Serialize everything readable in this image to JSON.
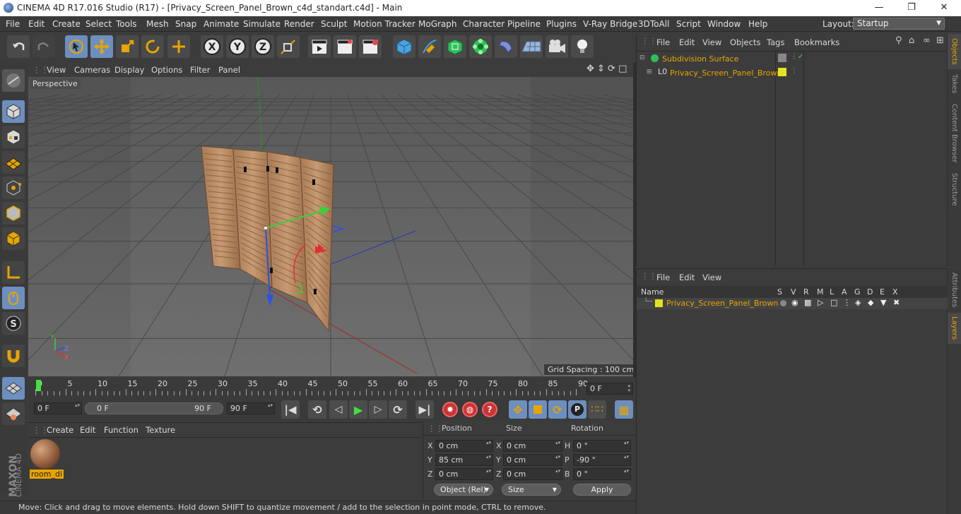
{
  "window": {
    "title": "CINEMA 4D R17.016 Studio (R17) - [Privacy_Screen_Panel_Brown_c4d_standart.c4d] - Main",
    "minimize": "—",
    "maximize": "❐",
    "close": "✕"
  },
  "menu": [
    "File",
    "Edit",
    "Create",
    "Select",
    "Tools",
    "Mesh",
    "Snap",
    "Animate",
    "Simulate",
    "Render",
    "Sculpt",
    "Motion Tracker",
    "MoGraph",
    "Character",
    "Pipeline",
    "Plugins",
    "V-Ray Bridge",
    "3DToAll",
    "Script",
    "Window",
    "Help"
  ],
  "layout": {
    "label": "Layout:",
    "value": "Startup"
  },
  "viewport": {
    "menu": [
      "View",
      "Cameras",
      "Display",
      "Options",
      "Filter",
      "Panel"
    ],
    "camera_label": "Perspective",
    "grid_spacing": "Grid Spacing : 100 cm",
    "axis_labels": {
      "y": "Y",
      "z": "Z",
      "x": "X"
    }
  },
  "timeline": {
    "ticks": [
      "0",
      "5",
      "10",
      "15",
      "20",
      "25",
      "30",
      "35",
      "40",
      "45",
      "50",
      "55",
      "60",
      "65",
      "70",
      "75",
      "80",
      "85",
      "90"
    ],
    "end_frame": "0 F"
  },
  "transport": {
    "current": "0 F",
    "range_start": "0 F",
    "range_end": "90 F",
    "max": "90 F"
  },
  "material_panel": {
    "menu": [
      "Create",
      "Edit",
      "Function",
      "Texture"
    ],
    "material_name": "room_di"
  },
  "coords": {
    "headers": [
      "Position",
      "Size",
      "Rotation"
    ],
    "rows": [
      {
        "axis": "X",
        "pos": "0 cm",
        "saxis": "X",
        "size": "0 cm",
        "raxis": "H",
        "rot": "0 °"
      },
      {
        "axis": "Y",
        "pos": "85 cm",
        "saxis": "Y",
        "size": "0 cm",
        "raxis": "P",
        "rot": "-90 °"
      },
      {
        "axis": "Z",
        "pos": "0 cm",
        "saxis": "Z",
        "size": "0 cm",
        "raxis": "B",
        "rot": "0 °"
      }
    ],
    "mode": "Object (Rel)",
    "size_mode": "Size",
    "apply": "Apply"
  },
  "objects_panel": {
    "menu": [
      "File",
      "Edit",
      "View",
      "Objects",
      "Tags",
      "Bookmarks"
    ],
    "items": [
      {
        "name": "Subdivision Surface"
      },
      {
        "name": "Privacy_Screen_Panel_Brown"
      }
    ]
  },
  "layers_panel": {
    "menu": [
      "File",
      "Edit",
      "View"
    ],
    "columns": [
      "Name",
      "S",
      "V",
      "R",
      "M",
      "L",
      "A",
      "G",
      "D",
      "E",
      "X"
    ],
    "items": [
      {
        "name": "Privacy_Screen_Panel_Brown"
      }
    ]
  },
  "side_tabs": [
    "Objects",
    "Takes",
    "Content Browser",
    "Structure"
  ],
  "side_tabs2": [
    "Attributes",
    "Layers"
  ],
  "brand": {
    "maxon": "MAXON",
    "product": "CINEMA 4D"
  },
  "status": "Move: Click and drag to move elements. Hold down SHIFT to quantize movement / add to the selection in point mode, CTRL to remove.",
  "colors": {
    "accent": "#e8a400",
    "highlight": "#6c8fbf",
    "background": "#3c3c3c"
  }
}
